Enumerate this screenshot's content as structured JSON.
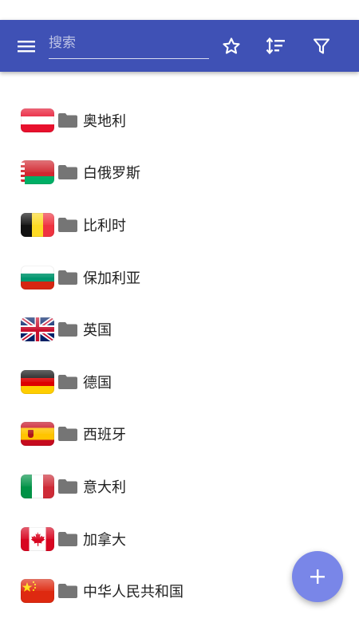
{
  "search": {
    "placeholder": "搜索"
  },
  "toolbar": {
    "menu_icon": "menu-icon",
    "favorite_icon": "star-outline-icon",
    "sort_icon": "sort-icon",
    "filter_icon": "filter-icon"
  },
  "countries": [
    {
      "name": "奥地利",
      "flag": "austria-flag-icon"
    },
    {
      "name": "白俄罗斯",
      "flag": "belarus-flag-icon"
    },
    {
      "name": "比利时",
      "flag": "belgium-flag-icon"
    },
    {
      "name": "保加利亚",
      "flag": "bulgaria-flag-icon"
    },
    {
      "name": "英国",
      "flag": "uk-flag-icon"
    },
    {
      "name": "德国",
      "flag": "germany-flag-icon"
    },
    {
      "name": "西班牙",
      "flag": "spain-flag-icon"
    },
    {
      "name": "意大利",
      "flag": "italy-flag-icon"
    },
    {
      "name": "加拿大",
      "flag": "canada-flag-icon"
    },
    {
      "name": "中华人民共和国",
      "flag": "china-flag-icon"
    }
  ],
  "fab": {
    "icon": "plus-icon"
  },
  "colors": {
    "appbar": "#3f51b5",
    "fab": "#7986e8",
    "folder": "#757575"
  }
}
